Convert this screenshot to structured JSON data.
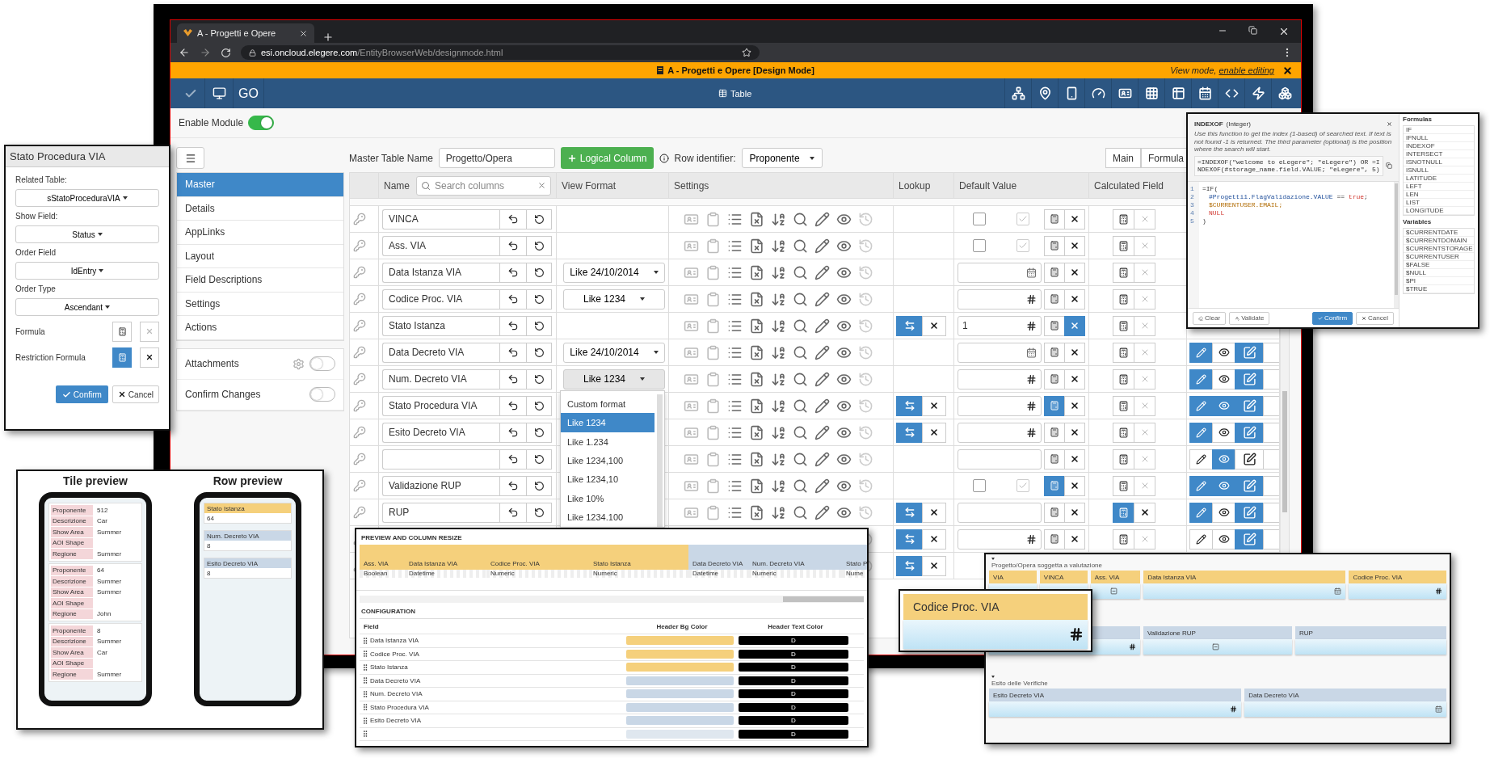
{
  "browser": {
    "tab_title": "A - Progetti e Opere",
    "url_host": "esi.oncloud.elegere.com",
    "url_path": "/EntityBrowserWeb/designmode.html"
  },
  "banner": {
    "title": "A - Progetti e Opere [Design Mode]",
    "mode_text": "View mode,",
    "mode_link": "enable editing"
  },
  "toolbar": {
    "go_label": "GO",
    "view_label": "Table"
  },
  "enable_module": {
    "label": "Enable Module",
    "on": true
  },
  "sidebar": {
    "items": [
      {
        "label": "Master",
        "selected": true
      },
      {
        "label": "Details",
        "selected": false
      },
      {
        "label": "AppLinks",
        "selected": false
      },
      {
        "label": "Layout",
        "selected": false
      },
      {
        "label": "Field Descriptions",
        "selected": false
      },
      {
        "label": "Settings",
        "selected": false
      },
      {
        "label": "Actions",
        "selected": false
      }
    ],
    "toggles": [
      {
        "label": "Attachments",
        "on": false,
        "settings": true
      },
      {
        "label": "Confirm Changes",
        "on": false,
        "settings": false
      }
    ]
  },
  "table_toolbar": {
    "master_table_label": "Master Table Name",
    "master_table_value": "Progetto/Opera",
    "add_button": "Logical Column",
    "row_identifier_label": "Row identifier:",
    "row_identifier_value": "Proponente",
    "tabs": [
      "Main",
      "Formula"
    ]
  },
  "table": {
    "columns": [
      "Name",
      "View Format",
      "Settings",
      "Lookup",
      "Default Value",
      "Calculated Field"
    ],
    "search_placeholder": "Search columns",
    "rows": [
      {
        "name": "VINCA",
        "lookup": false,
        "default": {
          "kind": "checkbox",
          "options": [
            {
              "checked": false
            },
            {
              "checked": true
            }
          ]
        },
        "formula_on": false,
        "clear_on": false,
        "calc_on": false
      },
      {
        "name": "Ass. VIA",
        "lookup": false,
        "default": {
          "kind": "checkbox",
          "options": [
            {
              "checked": false
            },
            {
              "checked": true
            }
          ]
        },
        "formula_on": false,
        "clear_on": false,
        "calc_on": false
      },
      {
        "name": "Data Istanza VIA",
        "format": {
          "label": "Like 24/10/2014",
          "open": false
        },
        "lookup": false,
        "default": {
          "kind": "date"
        },
        "formula_on": false,
        "clear_on": false,
        "calc_on": false
      },
      {
        "name": "Codice Proc. VIA",
        "format": {
          "label": "Like 1234",
          "open": false
        },
        "lookup": false,
        "default": {
          "kind": "number"
        },
        "formula_on": false,
        "clear_on": false,
        "calc_on": false
      },
      {
        "name": "Stato Istanza",
        "lookup": true,
        "default": {
          "kind": "number",
          "value": "1"
        },
        "formula_on": false,
        "clear_on": true,
        "calc_on": false
      },
      {
        "name": "Data Decreto VIA",
        "format": {
          "label": "Like 24/10/2014",
          "open": false
        },
        "lookup": false,
        "default": {
          "kind": "date"
        },
        "formula_on": false,
        "clear_on": false,
        "calc_on": false,
        "actions": [
          true,
          false,
          true
        ]
      },
      {
        "name": "Num. Decreto VIA",
        "format": {
          "label": "Like 1234",
          "open": true
        },
        "lookup": false,
        "default": {
          "kind": "number"
        },
        "formula_on": false,
        "clear_on": false,
        "calc_on": false,
        "actions": [
          true,
          false,
          true
        ]
      },
      {
        "name": "Stato Procedura VIA",
        "lookup": true,
        "default": {
          "kind": "number"
        },
        "formula_on": true,
        "clear_on": false,
        "calc_on": false,
        "actions": [
          true,
          true,
          true
        ]
      },
      {
        "name": "Esito Decreto VIA",
        "lookup": true,
        "default": {
          "kind": "number"
        },
        "formula_on": false,
        "clear_on": false,
        "calc_on": false,
        "actions": [
          true,
          false,
          true
        ]
      },
      {
        "lookup": false,
        "default": {
          "kind": "text"
        },
        "formula_on": false,
        "clear_on": false,
        "calc_on": false,
        "actions": [
          false,
          true,
          false
        ]
      },
      {
        "name": "Validazione RUP",
        "lookup": false,
        "default": {
          "kind": "checkbox",
          "options": [
            {
              "checked": false
            },
            {
              "checked": true
            }
          ]
        },
        "formula_on": true,
        "clear_on": false,
        "calc_on": false,
        "actions": [
          true,
          true,
          true
        ]
      },
      {
        "name": "RUP",
        "lookup": true,
        "default": {
          "kind": "text"
        },
        "formula_on": false,
        "clear_on": false,
        "calc_on": true,
        "actions": [
          true,
          false,
          true
        ]
      },
      {
        "lookup": true,
        "default": {
          "kind": "number"
        },
        "formula_on": false,
        "clear_on": false,
        "calc_on": false,
        "actions": [
          false,
          false,
          true
        ]
      },
      {
        "lookup": true
      }
    ]
  },
  "format_menu": {
    "items": [
      {
        "label": "Custom format",
        "selected": false
      },
      {
        "label": "Like 1234",
        "selected": true
      },
      {
        "label": "Like 1.234",
        "selected": false
      },
      {
        "label": "Like 1234,100",
        "selected": false
      },
      {
        "label": "Like 1234,10",
        "selected": false
      },
      {
        "label": "Like 10%",
        "selected": false
      },
      {
        "label": "Like 1234.100",
        "selected": false
      }
    ]
  },
  "lookup_dialog": {
    "title": "Stato Procedura VIA",
    "fields": [
      {
        "label": "Related Table:",
        "value": "sStatoProceduraVIA"
      },
      {
        "label": "Show Field:",
        "value": "Status"
      },
      {
        "label": "Order Field",
        "value": "IdEntry"
      },
      {
        "label": "Order Type",
        "value": "Ascendant"
      }
    ],
    "formulas": [
      {
        "label": "Formula",
        "on": false
      },
      {
        "label": "Restriction Formula",
        "on": true
      }
    ],
    "confirm": "Confirm",
    "cancel": "Cancel"
  },
  "tile_preview": {
    "title": "Tile preview",
    "tiles": [
      {
        "fields": [
          {
            "label": "Proponente",
            "value": "512"
          },
          {
            "label": "Descrizione",
            "value": "Car"
          },
          {
            "label": "Show Area",
            "value": "Summer"
          },
          {
            "label": "AOI Shape"
          },
          {
            "label": "Regione",
            "value": "Summer"
          }
        ]
      },
      {
        "fields": [
          {
            "label": "Proponente",
            "value": "64"
          },
          {
            "label": "Descrizione",
            "value": "Summer"
          },
          {
            "label": "Show Area",
            "value": "Summer"
          },
          {
            "label": "AOI Shape"
          },
          {
            "label": "Regione",
            "value": "John"
          }
        ]
      },
      {
        "fields": [
          {
            "label": "Proponente",
            "value": "8"
          },
          {
            "label": "Descrizione",
            "value": "Summer"
          },
          {
            "label": "Show Area",
            "value": "Car"
          },
          {
            "label": "AOI Shape"
          },
          {
            "label": "Regione",
            "value": "Summer"
          }
        ]
      }
    ]
  },
  "row_preview": {
    "title": "Row preview",
    "items": [
      {
        "label": "Stato Istanza",
        "value": "64",
        "color": "#f5d07c"
      },
      {
        "label": "Num. Decreto VIA",
        "value": "8",
        "color": "#c9d7e6"
      },
      {
        "label": "Esito Decreto VIA",
        "value": "8",
        "color": "#c9d7e6"
      }
    ]
  },
  "column_preview": {
    "title": "PREVIEW AND COLUMN RESIZE",
    "columns": [
      {
        "label": "Ass. VIA",
        "type": "Boolean",
        "color": "#f5d07c"
      },
      {
        "label": "Data Istanza VIA",
        "type": "Datetime",
        "color": "#f5d07c"
      },
      {
        "label": "Codice Proc. VIA",
        "type": "Numeric",
        "color": "#f5d07c"
      },
      {
        "label": "Stato Istanza",
        "type": "Numeric",
        "color": "#f5d07c"
      },
      {
        "label": "Data Decreto VIA",
        "type": "Datetime",
        "color": "#c9d7e6"
      },
      {
        "label": "Num. Decreto VIA",
        "type": "Numeric",
        "color": "#c9d7e6"
      },
      {
        "label": "Stato P",
        "type": "Nume",
        "color": "#c9d7e6"
      }
    ],
    "config_title": "CONFIGURATION",
    "config_columns": [
      "Field",
      "Header Bg Color",
      "Header Text Color"
    ],
    "config_rows": [
      {
        "field": "Data Istanza VIA",
        "color": "#f5d07c",
        "sample": "D"
      },
      {
        "field": "Codice Proc. VIA",
        "color": "#f5d07c",
        "sample": "D"
      },
      {
        "field": "Stato Istanza",
        "color": "#f5d07c",
        "sample": "D"
      },
      {
        "field": "Data Decreto VIA",
        "color": "#c9d7e6",
        "sample": "D"
      },
      {
        "field": "Num. Decreto VIA",
        "color": "#c9d7e6",
        "sample": "D"
      },
      {
        "field": "Stato Procedura VIA",
        "color": "#c9d7e6",
        "sample": "D"
      },
      {
        "field": "Esito Decreto VIA",
        "color": "#c9d7e6",
        "sample": "D"
      },
      {
        "color": "#dfe7ef",
        "sample": "D"
      }
    ]
  },
  "field_popup": {
    "label": "Codice Proc. VIA",
    "color": "#f5d07c",
    "kind": "number"
  },
  "layout_panel": {
    "sections": [
      {
        "title": "Progetto/Opera soggetta a valutazione",
        "fields": [
          {
            "label": "VIA",
            "color": "#f5d07c",
            "kind": "plain"
          },
          {
            "label": "VINCA",
            "color": "#f5d07c",
            "kind": "plain"
          },
          {
            "label": "Ass. VIA",
            "color": "#f5d07c",
            "kind": "boolean"
          },
          {
            "label": "Data Istanza VIA",
            "color": "#f5d07c",
            "kind": "date"
          },
          {
            "label": "Codice Proc. VIA",
            "color": "#f5d07c",
            "kind": "number"
          }
        ]
      },
      {
        "fields": [
          {
            "color": "#c9d7e6",
            "kind": "number"
          },
          {
            "label": "Validazione RUP",
            "color": "#c9d7e6",
            "kind": "boolean"
          },
          {
            "label": "RUP",
            "color": "#c9d7e6",
            "kind": "plain"
          }
        ]
      },
      {
        "title": "Esito delle Verifiche",
        "fields": [
          {
            "label": "Esito Decreto VIA",
            "color": "#c9d7e6",
            "kind": "number"
          },
          {
            "label": "Data Decreto VIA",
            "color": "#c9d7e6",
            "kind": "date"
          }
        ]
      }
    ]
  },
  "formula_dialog": {
    "function_name": "INDEXOF",
    "return_type": "(Integer)",
    "description": "Use this function to get the index (1-based) of searched text. If text is not found -1 is returned. The third parameter (optional) is the position where the search will start.",
    "example": "=INDEXOF(\"welcome to eLegere\"; \"eLegere\") OR =INDEXOF(#storage_name.field.VALUE; \"eLegere\", 5)",
    "code": [
      {
        "number": "1",
        "tokens": [
          {
            "text": "=IF(",
            "kind": "plain"
          }
        ]
      },
      {
        "number": "2",
        "tokens": [
          {
            "text": "#Progetti1.FlagValidazione.VALUE",
            "kind": "field"
          },
          {
            "text": " == ",
            "kind": "plain"
          },
          {
            "text": "true",
            "kind": "keyword"
          },
          {
            "text": ";",
            "kind": "plain"
          }
        ]
      },
      {
        "number": "3",
        "tokens": [
          {
            "text": "$CURRENTUSER.EMAIL;",
            "kind": "variable"
          }
        ]
      },
      {
        "number": "4",
        "tokens": [
          {
            "text": "NULL",
            "kind": "keyword"
          }
        ]
      },
      {
        "number": "5",
        "tokens": [
          {
            "text": ")",
            "kind": "plain"
          }
        ]
      }
    ],
    "formulas_title": "Formulas",
    "formulas": [
      "IF",
      "IFNULL",
      "INDEXOF",
      "INTERSECT",
      "ISNOTNULL",
      "ISNULL",
      "LATITUDE",
      "LEFT",
      "LEN",
      "LIST",
      "LONGITUDE"
    ],
    "variables_title": "Variables",
    "variables": [
      "$CURRENTDATE",
      "$CURRENTDOMAIN",
      "$CURRENTSTORAGE",
      "$CURRENTUSER",
      "$FALSE",
      "$NULL",
      "$PI",
      "$TRUE"
    ],
    "clear": "Clear",
    "validate": "Validate",
    "confirm": "Confirm",
    "cancel": "Cancel"
  }
}
